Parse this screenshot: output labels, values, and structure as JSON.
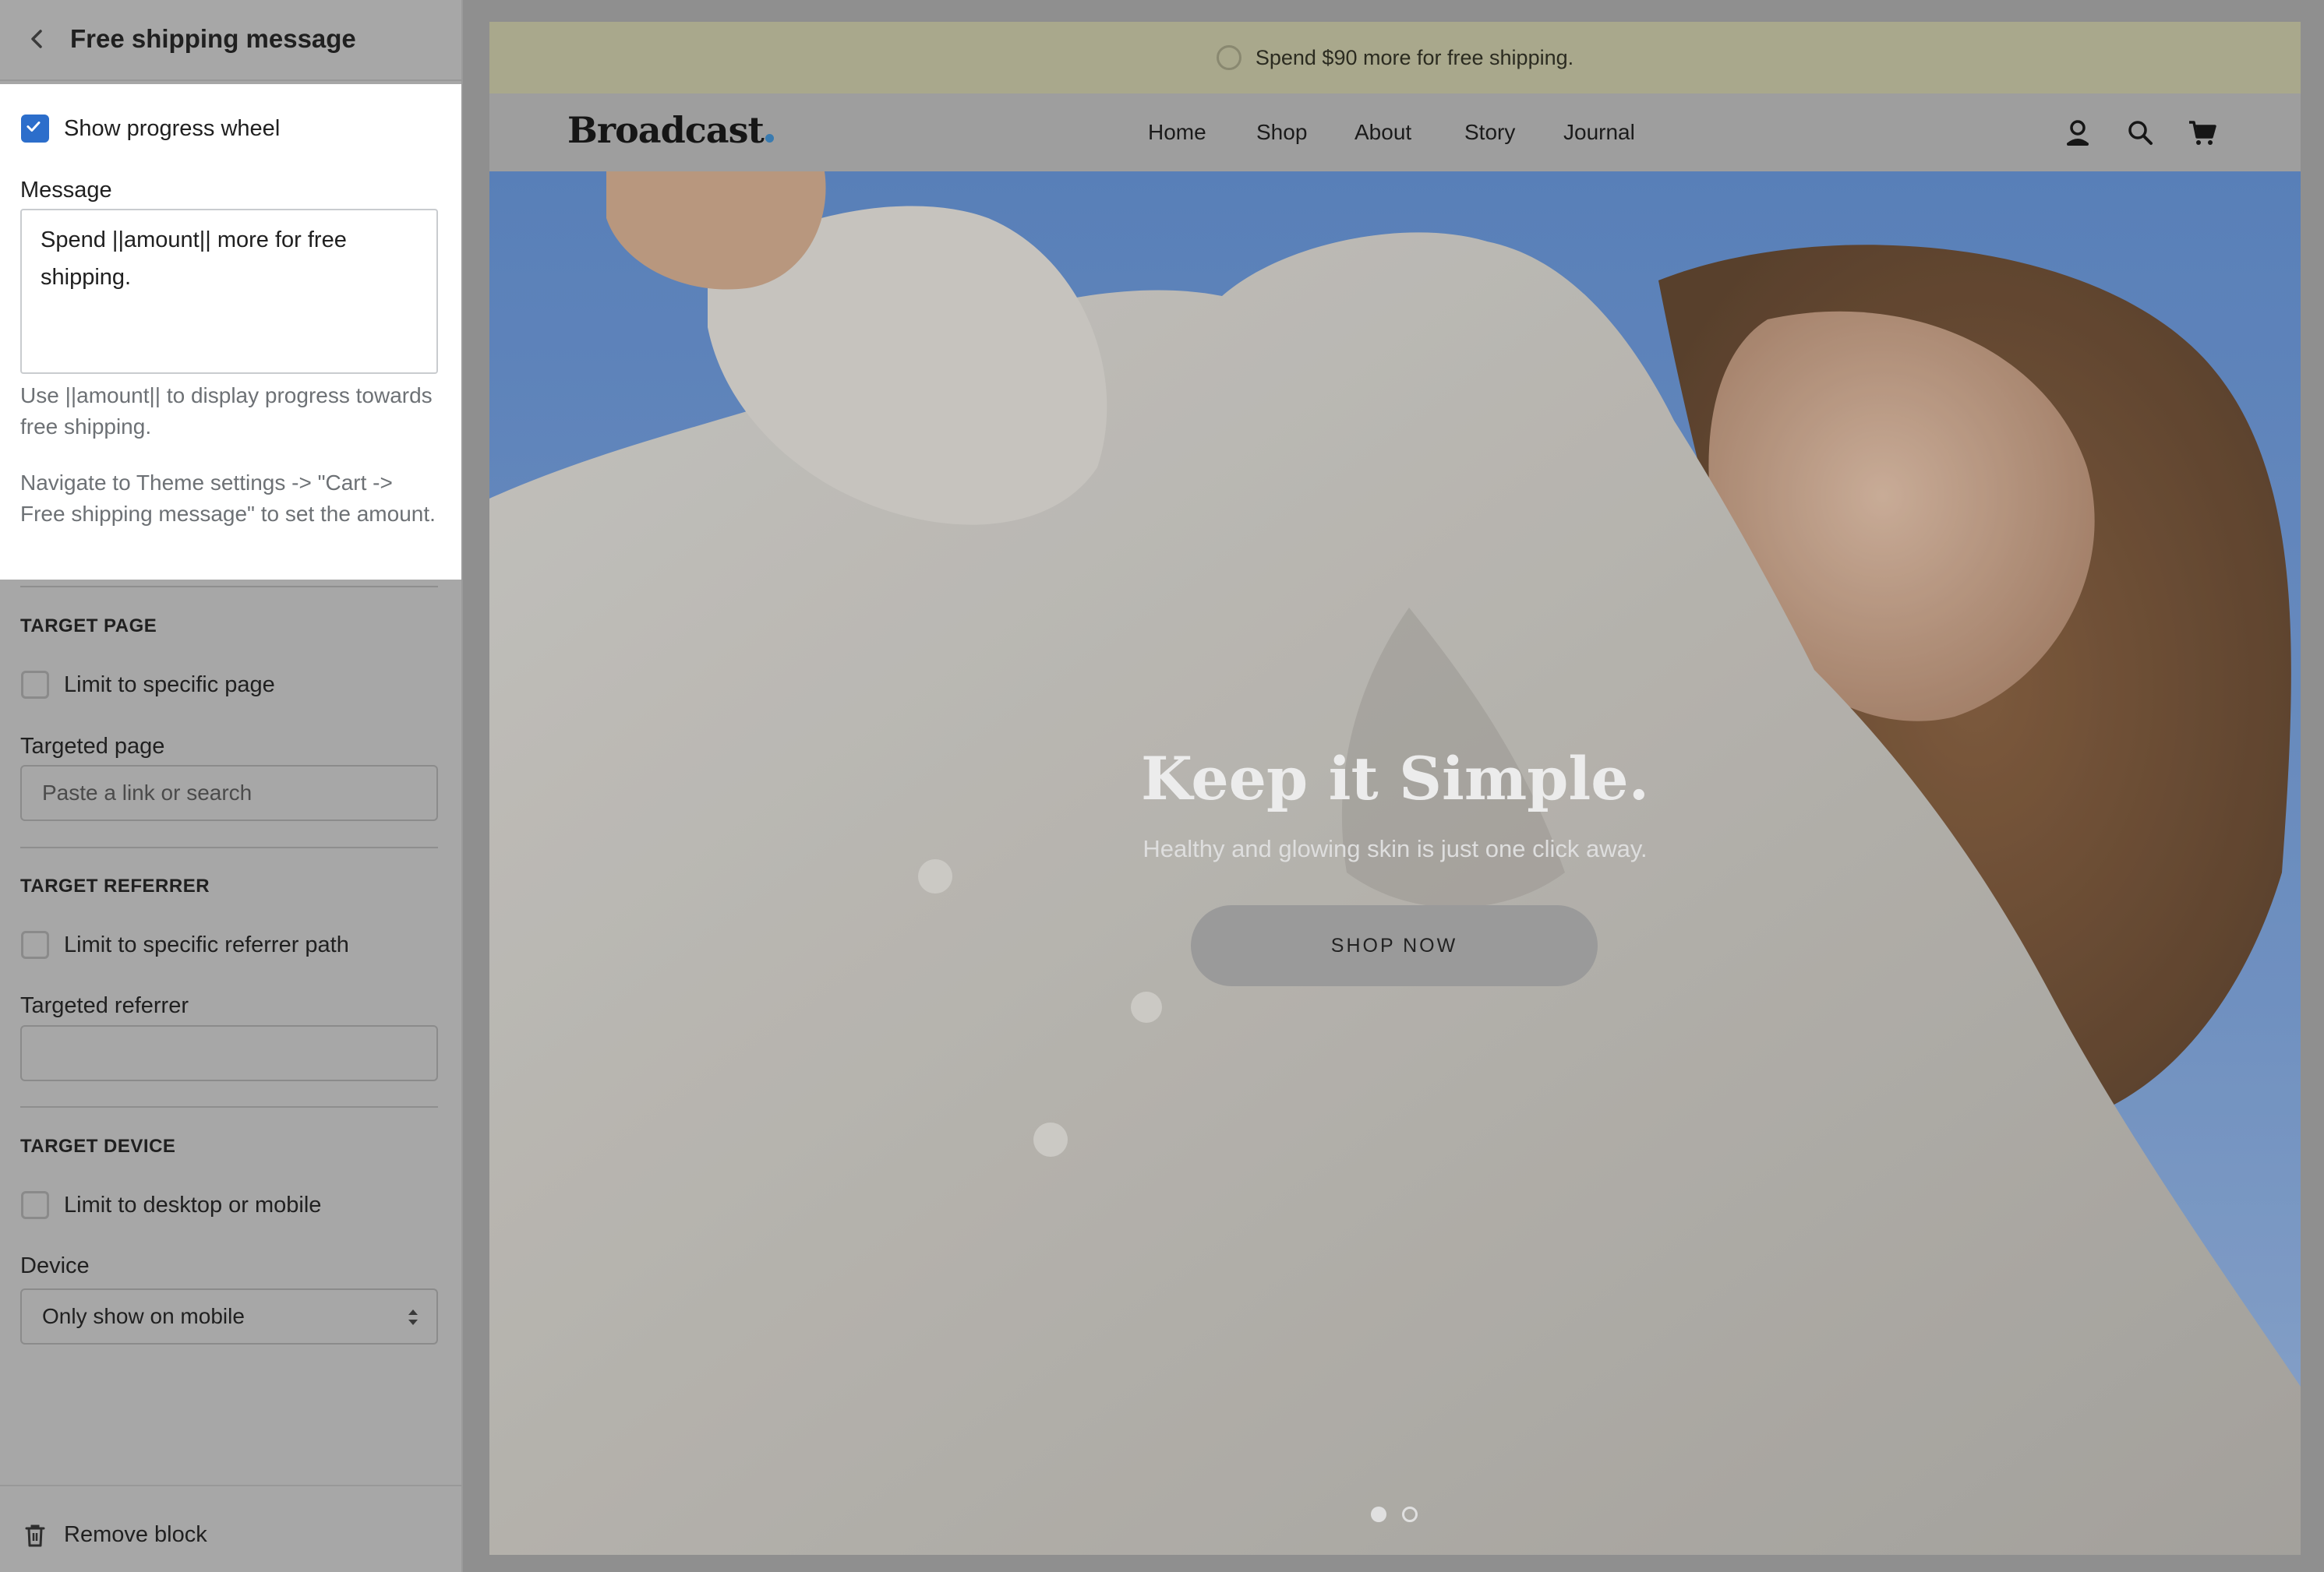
{
  "sidebar": {
    "title": "Free shipping message",
    "progress_checkbox_label": "Show progress wheel",
    "message_label": "Message",
    "message_value": "Spend ||amount|| more for free shipping.",
    "help_1": "Use ||amount|| to display progress towards free shipping.",
    "help_2": "Navigate to Theme settings -> \"Cart -> Free shipping message\" to set the amount.",
    "target_page": {
      "heading": "TARGET PAGE",
      "checkbox_label": "Limit to specific page",
      "field_label": "Targeted page",
      "placeholder": "Paste a link or search"
    },
    "target_referrer": {
      "heading": "TARGET REFERRER",
      "checkbox_label": "Limit to specific referrer path",
      "field_label": "Targeted referrer",
      "value": ""
    },
    "target_device": {
      "heading": "TARGET DEVICE",
      "checkbox_label": "Limit to desktop or mobile",
      "field_label": "Device",
      "selected": "Only show on mobile"
    },
    "remove_label": "Remove block"
  },
  "preview": {
    "announcement": "Spend $90 more for free shipping.",
    "logo": "Broadcast",
    "nav": [
      "Home",
      "Shop",
      "About",
      "Story",
      "Journal"
    ],
    "hero": {
      "title": "Keep it Simple.",
      "subtitle": "Healthy and glowing skin is just one click away.",
      "button": "SHOP NOW"
    }
  },
  "colors": {
    "accent": "#2c6ecb",
    "logo_dot": "#3a7bb0",
    "announcement_bg": "#a9a88c"
  }
}
